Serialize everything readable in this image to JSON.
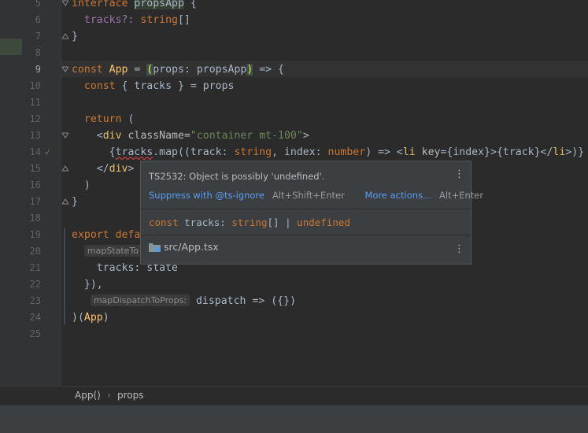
{
  "editor": {
    "line_numbers": [
      "5",
      "6",
      "7",
      "8",
      "9",
      "10",
      "11",
      "12",
      "13",
      "14",
      "15",
      "16",
      "17",
      "18",
      "19",
      "20",
      "21",
      "22",
      "23",
      "24",
      "25"
    ],
    "current_line": "9",
    "code": {
      "l5_kw": "interface ",
      "l5_name": "propsApp",
      "l5_rest": " {",
      "l6_field": "  tracks?: ",
      "l6_type": "string",
      "l6_rest": "[]",
      "l7": "}",
      "l9_kw": "const ",
      "l9_fn": "App",
      "l9_mid": " = ",
      "l9_paren": "(",
      "l9_args": "props: propsApp",
      "l9_paren2": ")",
      "l9_rest": " => {",
      "l10_kw": "  const ",
      "l10_rest": "{ tracks } = props",
      "l12_kw": "  return ",
      "l12_rest": "(",
      "l13_lt": "    <",
      "l13_tag": "div ",
      "l13_attr": "className",
      "l13_eq": "=",
      "l13_str": "\"container mt-100\"",
      "l13_gt": ">",
      "l14_a": "      {",
      "l14_err": "tracks",
      "l14_b": ".map((track: ",
      "l14_t1": "string",
      "l14_c": ", index: ",
      "l14_t2": "number",
      "l14_d": ") => <",
      "l14_li": "li ",
      "l14_key": "key",
      "l14_e": "={index}>{track}</",
      "l14_li2": "li",
      "l14_f": ">)}",
      "l15_lt": "    </",
      "l15_tag": "div",
      "l15_gt": ">",
      "l16": "  )",
      "l17": "}",
      "l19_kw": "export ",
      "l19_rest": "defa",
      "l20_hint": "mapStateTo",
      "l21": "    tracks: state",
      "l22": "  }),",
      "l23_hint": "mapDispatchToProps:",
      "l23_rest": " dispatch => ({})",
      "l24_a": ")(",
      "l24_fn": "App",
      "l24_b": ")"
    }
  },
  "popup": {
    "message": "TS2532: Object is possibly 'undefined'.",
    "suppress_label": "Suppress with @ts-ignore",
    "suppress_keys": "Alt+Shift+Enter",
    "more_label": "More actions...",
    "more_keys": "Alt+Enter",
    "sig_kw": "const ",
    "sig_name": "tracks: ",
    "sig_type": "string",
    "sig_mid": "[] | ",
    "sig_undef": "undefined",
    "file": "src/App.tsx",
    "menu_icon": "⋮"
  },
  "breadcrumbs": {
    "item1": "App()",
    "sep": "›",
    "item2": "props"
  },
  "colors": {
    "background": "#2b2b2b",
    "keyword": "#cc7832",
    "function": "#ffc66d",
    "string": "#6a8759",
    "link": "#589df6",
    "error": "#bc3f3c"
  }
}
